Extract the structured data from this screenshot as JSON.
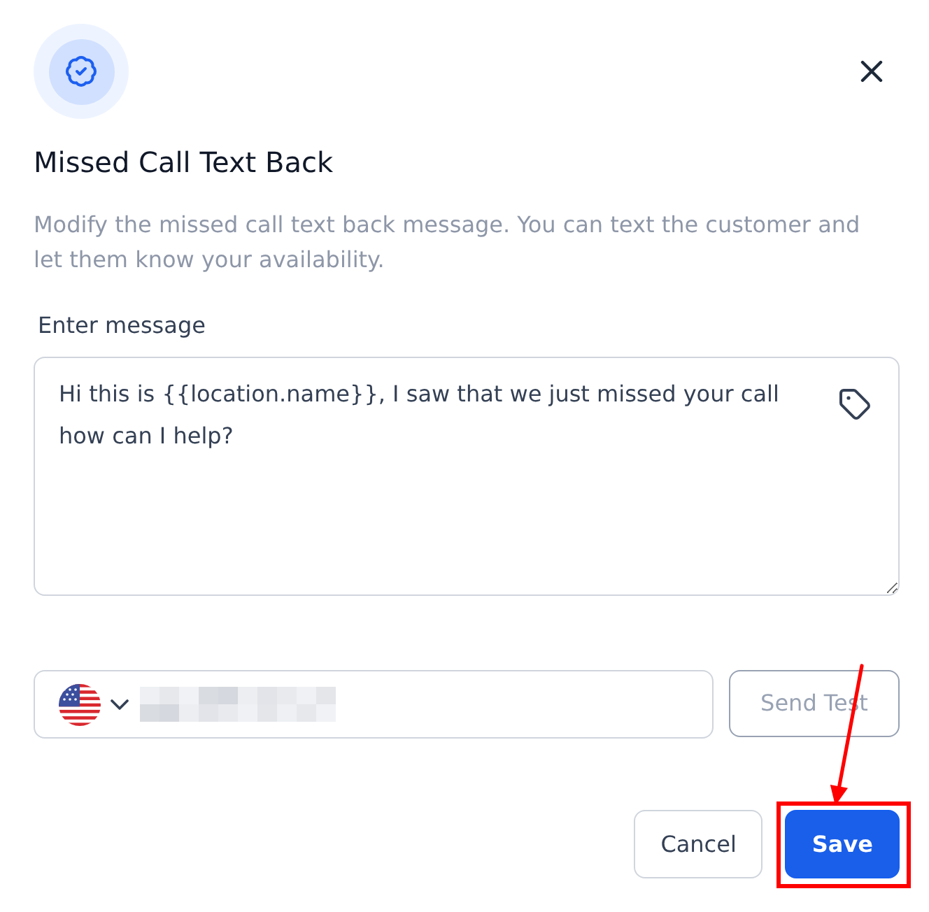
{
  "dialog": {
    "title": "Missed Call Text Back",
    "description": "Modify the missed call text back message. You can text the customer and let them know your availability."
  },
  "message": {
    "label": "Enter message",
    "value": "Hi this is {{location.name}}, I saw that we just missed your call how can I help?"
  },
  "test": {
    "send_button": {
      "label": "Send Test",
      "disabled": true
    }
  },
  "footer": {
    "buttons": [
      {
        "label": "Cancel",
        "kind": "secondary",
        "highlighted": false
      },
      {
        "label": "Save",
        "kind": "primary",
        "highlighted": true
      }
    ]
  }
}
